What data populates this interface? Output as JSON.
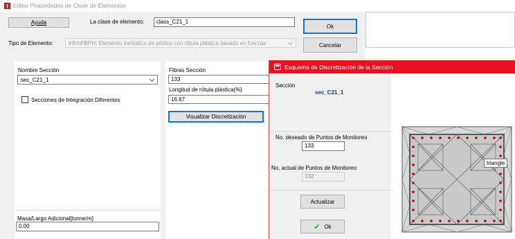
{
  "window": {
    "title": "Editar Propiedades de Clase de Elementos"
  },
  "toolbar": {
    "help_label": "Ayuda",
    "class_label": "La clase de elemento:",
    "class_value": "class_C21_1",
    "ok_label": "Ok",
    "cancel_label": "Cancelar",
    "element_type_label": "Tipo de Elemento:",
    "element_type_value": "infrmFBPH: Elemento inelástico de pórtico con rótula plástica basado en fuerzas"
  },
  "section_panel": {
    "section_name_label": "Nombre Sección",
    "section_name_value": "sec_C21_1",
    "different_integration_label": "Secciones de Integración Diferentes",
    "mass_label": "Masa/Largo Adicional[tonne/m]",
    "mass_value": "0.00"
  },
  "fiber_panel": {
    "fibers_label": "Fibras Sección",
    "fibers_value": "133",
    "hinge_length_label": "Longitud de rótula plástica(%)",
    "hinge_length_value": "16.67",
    "visualize_label": "Visualizar Discretización"
  },
  "dialog": {
    "title": "Esquema de Discretización de la Sección",
    "section_label": "Sección",
    "section_value": "sec_C21_1",
    "desired_points_label": "No. deseado de Puntos de Monitoreo",
    "desired_points_value": "133",
    "actual_points_label": "No. actual de Puntos de Monitoreo",
    "actual_points_value": "132",
    "update_label": "Actualizar",
    "ok_label": "Ok"
  },
  "drawing": {
    "tooltip": "triangle"
  },
  "colors": {
    "dialog_titlebar": "#e81123",
    "rebar": "#c00000",
    "ok_check": "#2e9e2e",
    "default_button_border": "#0078d7"
  }
}
